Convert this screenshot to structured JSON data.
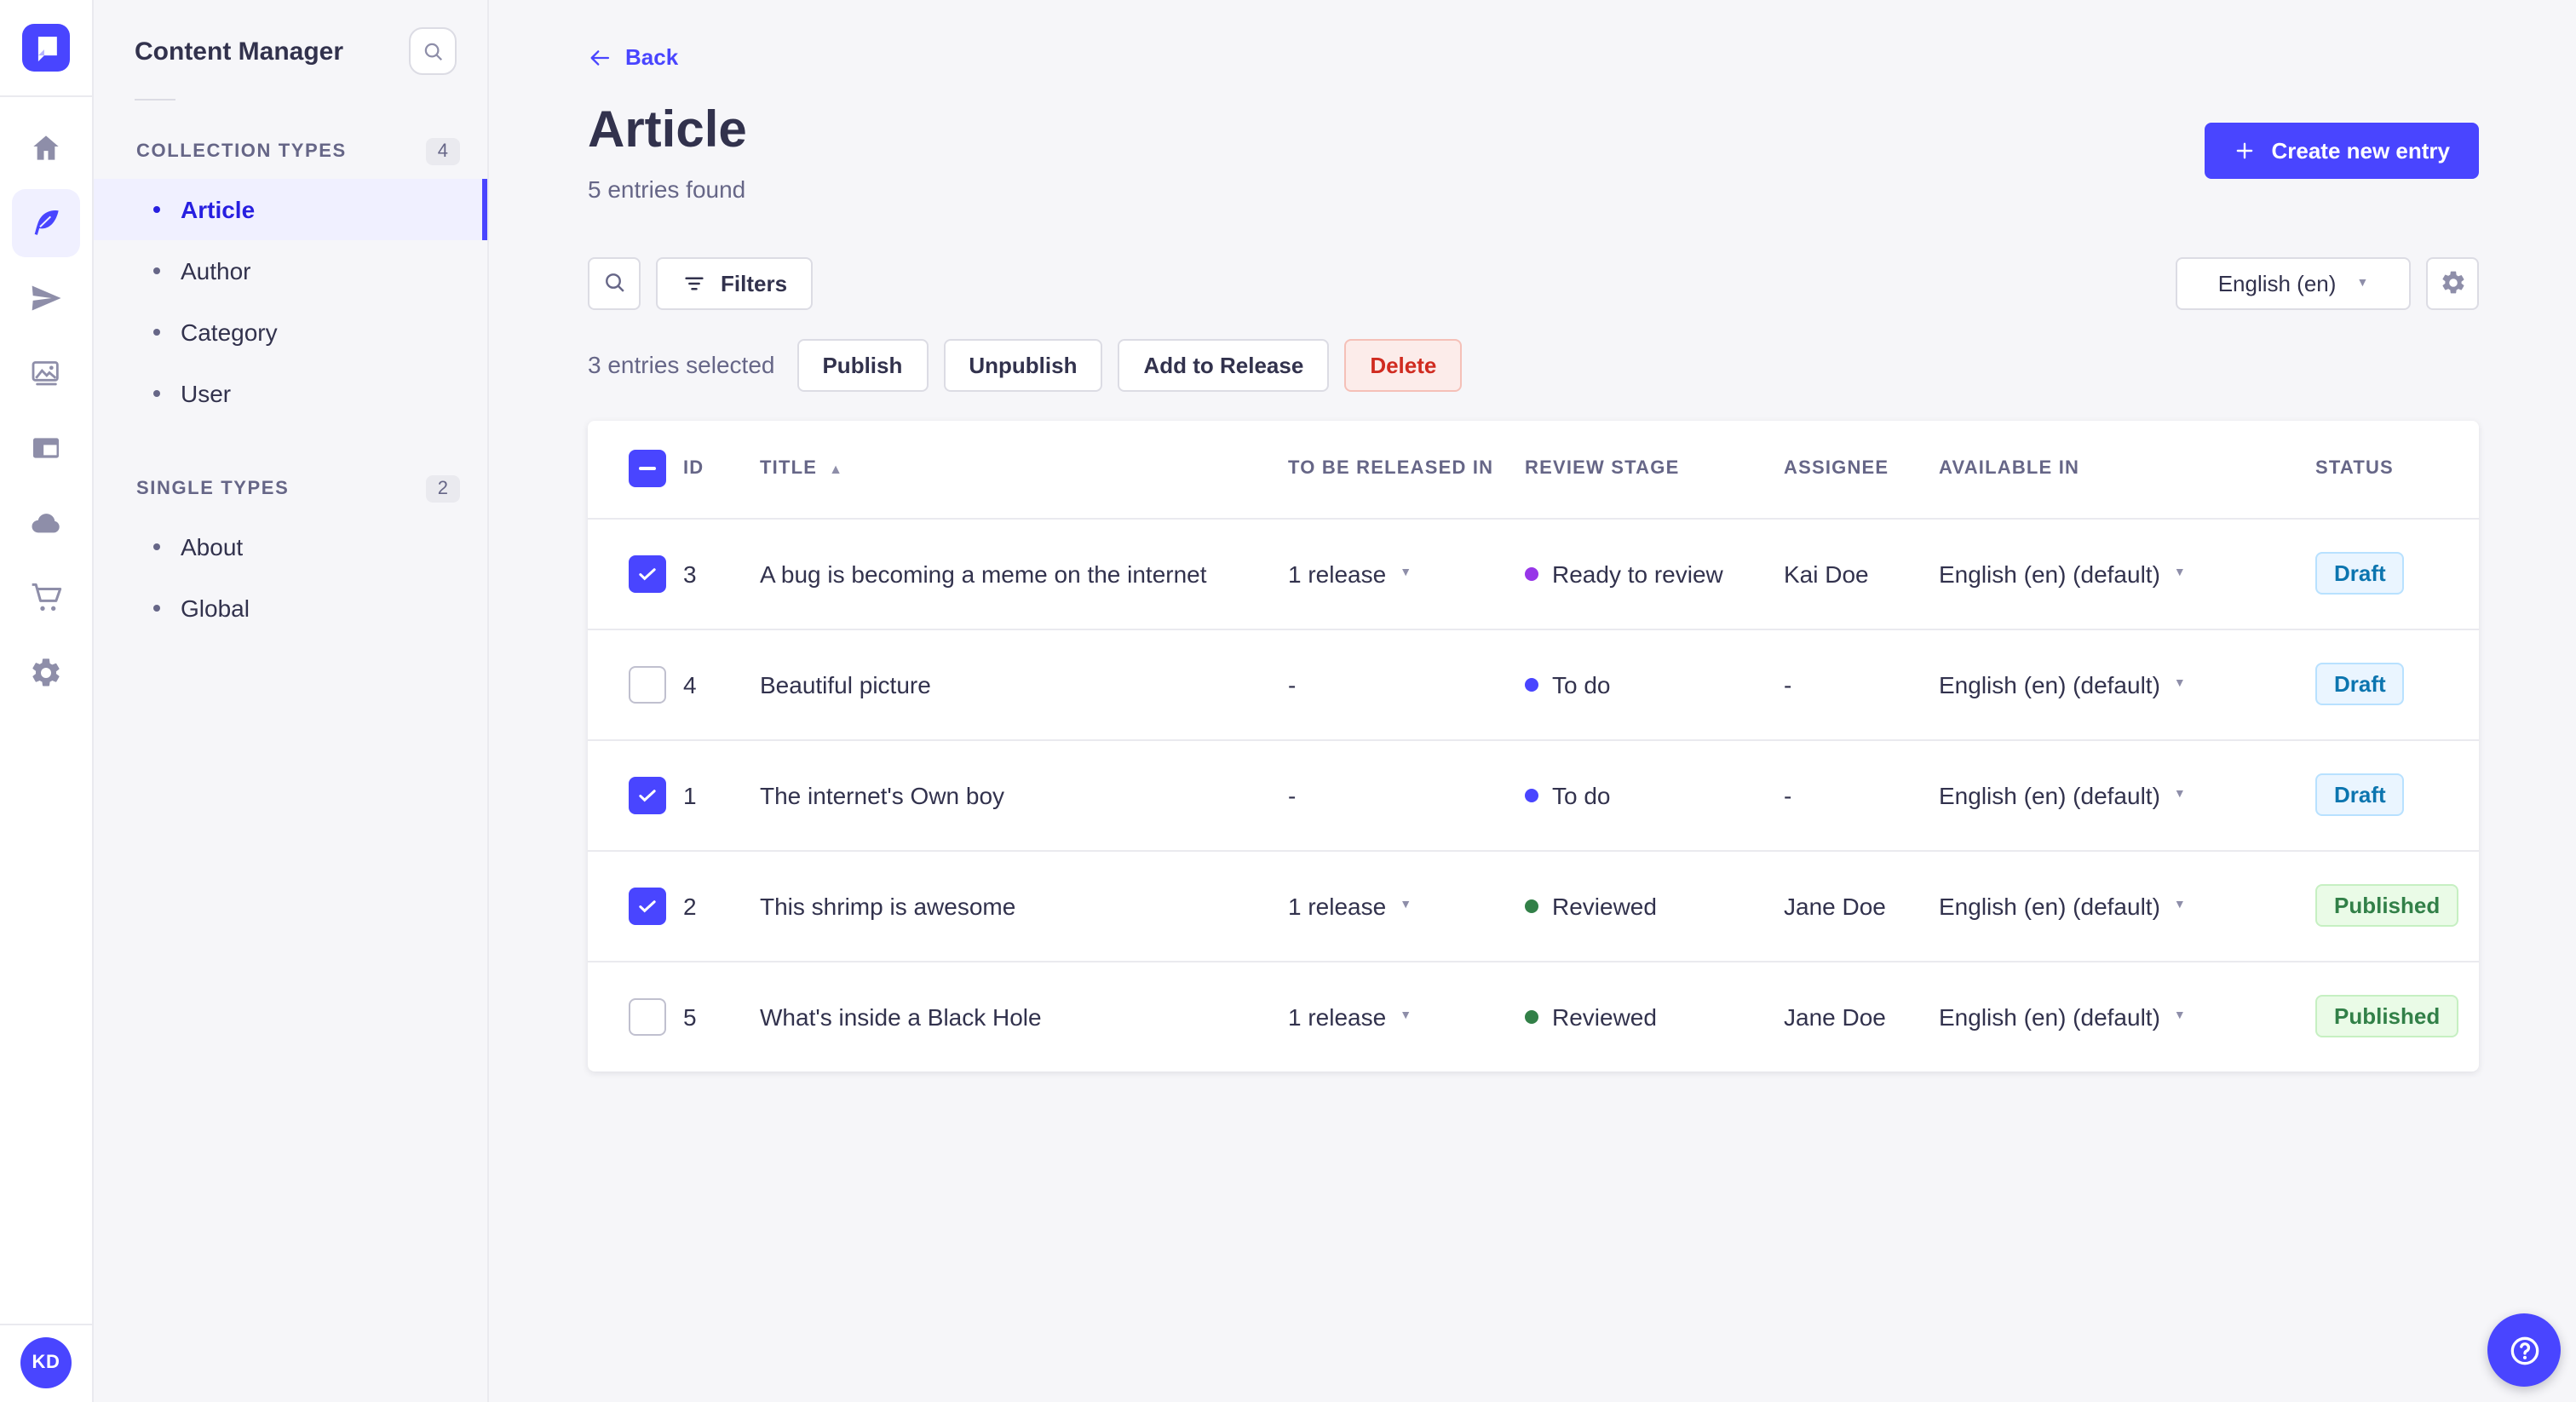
{
  "colors": {
    "accent": "#4945ff",
    "active_text": "#271fe0",
    "stage_purple": "#9736e8",
    "stage_blue": "#4945ff",
    "stage_green": "#328048",
    "danger": "#d02b20"
  },
  "nav": {
    "avatar_initials": "KD",
    "icons": [
      "home",
      "feather",
      "paper-plane",
      "images",
      "layout",
      "cloud",
      "cart",
      "gear"
    ],
    "active_icon": "feather"
  },
  "subnav": {
    "title": "Content Manager",
    "sections": [
      {
        "label": "COLLECTION TYPES",
        "count": "4",
        "items": [
          {
            "label": "Article",
            "active": true
          },
          {
            "label": "Author",
            "active": false
          },
          {
            "label": "Category",
            "active": false
          },
          {
            "label": "User",
            "active": false
          }
        ]
      },
      {
        "label": "SINGLE TYPES",
        "count": "2",
        "items": [
          {
            "label": "About",
            "active": false
          },
          {
            "label": "Global",
            "active": false
          }
        ]
      }
    ]
  },
  "header": {
    "back_label": "Back",
    "title": "Article",
    "subtitle": "5 entries found",
    "create_button_label": "Create new entry"
  },
  "toolbar": {
    "filters_label": "Filters",
    "locale_value": "English (en)"
  },
  "selection": {
    "label": "3 entries selected",
    "actions": [
      "Publish",
      "Unpublish",
      "Add to Release",
      "Delete"
    ]
  },
  "table": {
    "select_all_state": "indeterminate",
    "sort": {
      "column": "TITLE",
      "direction": "asc"
    },
    "headers": [
      "ID",
      "TITLE",
      "TO BE RELEASED IN",
      "REVIEW STAGE",
      "ASSIGNEE",
      "AVAILABLE IN",
      "STATUS"
    ],
    "rows": [
      {
        "checked": true,
        "id": "3",
        "title": "A bug is becoming a meme on the internet",
        "to_be_released_in": "1 release",
        "has_release_menu": true,
        "review_stage": "Ready to review",
        "stage_color": "#9736e8",
        "assignee": "Kai Doe",
        "available_in": "English (en) (default)",
        "status": "Draft"
      },
      {
        "checked": false,
        "id": "4",
        "title": "Beautiful picture",
        "to_be_released_in": "-",
        "has_release_menu": false,
        "review_stage": "To do",
        "stage_color": "#4945ff",
        "assignee": "-",
        "available_in": "English (en) (default)",
        "status": "Draft"
      },
      {
        "checked": true,
        "id": "1",
        "title": "The internet's Own boy",
        "to_be_released_in": "-",
        "has_release_menu": false,
        "review_stage": "To do",
        "stage_color": "#4945ff",
        "assignee": "-",
        "available_in": "English (en) (default)",
        "status": "Draft"
      },
      {
        "checked": true,
        "id": "2",
        "title": "This shrimp is awesome",
        "to_be_released_in": "1 release",
        "has_release_menu": true,
        "review_stage": "Reviewed",
        "stage_color": "#328048",
        "assignee": "Jane Doe",
        "available_in": "English (en) (default)",
        "status": "Published"
      },
      {
        "checked": false,
        "id": "5",
        "title": "What's inside a Black Hole",
        "to_be_released_in": "1 release",
        "has_release_menu": true,
        "review_stage": "Reviewed",
        "stage_color": "#328048",
        "assignee": "Jane Doe",
        "available_in": "English (en) (default)",
        "status": "Published"
      }
    ]
  }
}
